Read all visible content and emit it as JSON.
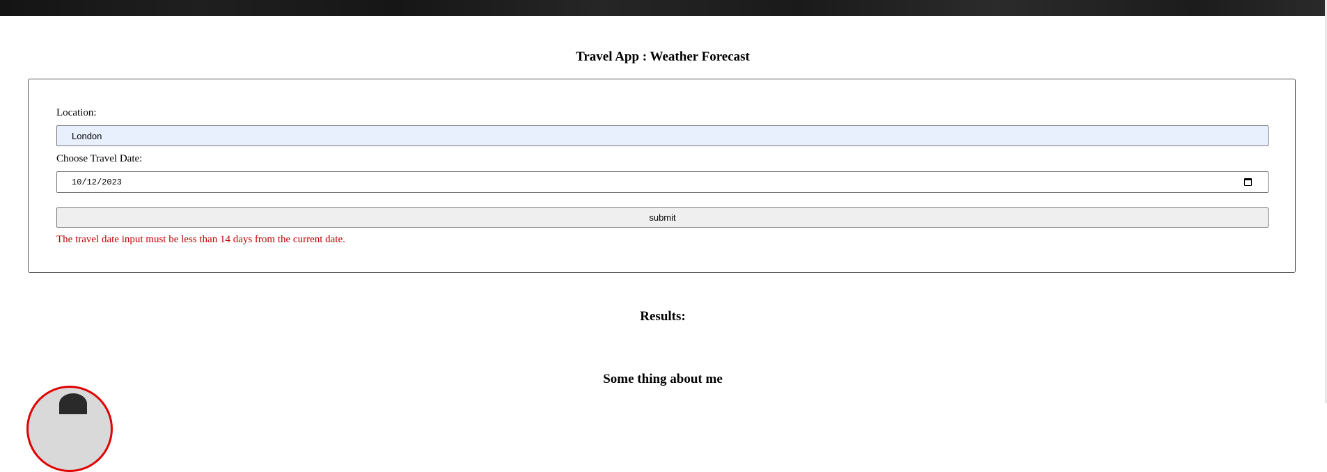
{
  "header": {
    "title": "Travel App : Weather Forecast"
  },
  "form": {
    "location_label": "Location:",
    "location_value": "London",
    "date_label": "Choose Travel Date:",
    "date_value": "10/12/2023",
    "submit_label": "submit",
    "error_message": "The travel date input must be less than 14 days from the current date."
  },
  "results": {
    "heading": "Results:"
  },
  "about": {
    "heading": "Some thing about me"
  },
  "colors": {
    "error": "#c00000",
    "input_autofill_bg": "#e8f0fe",
    "avatar_border": "#e00000"
  },
  "icons": {
    "date_picker": "calendar-icon"
  }
}
